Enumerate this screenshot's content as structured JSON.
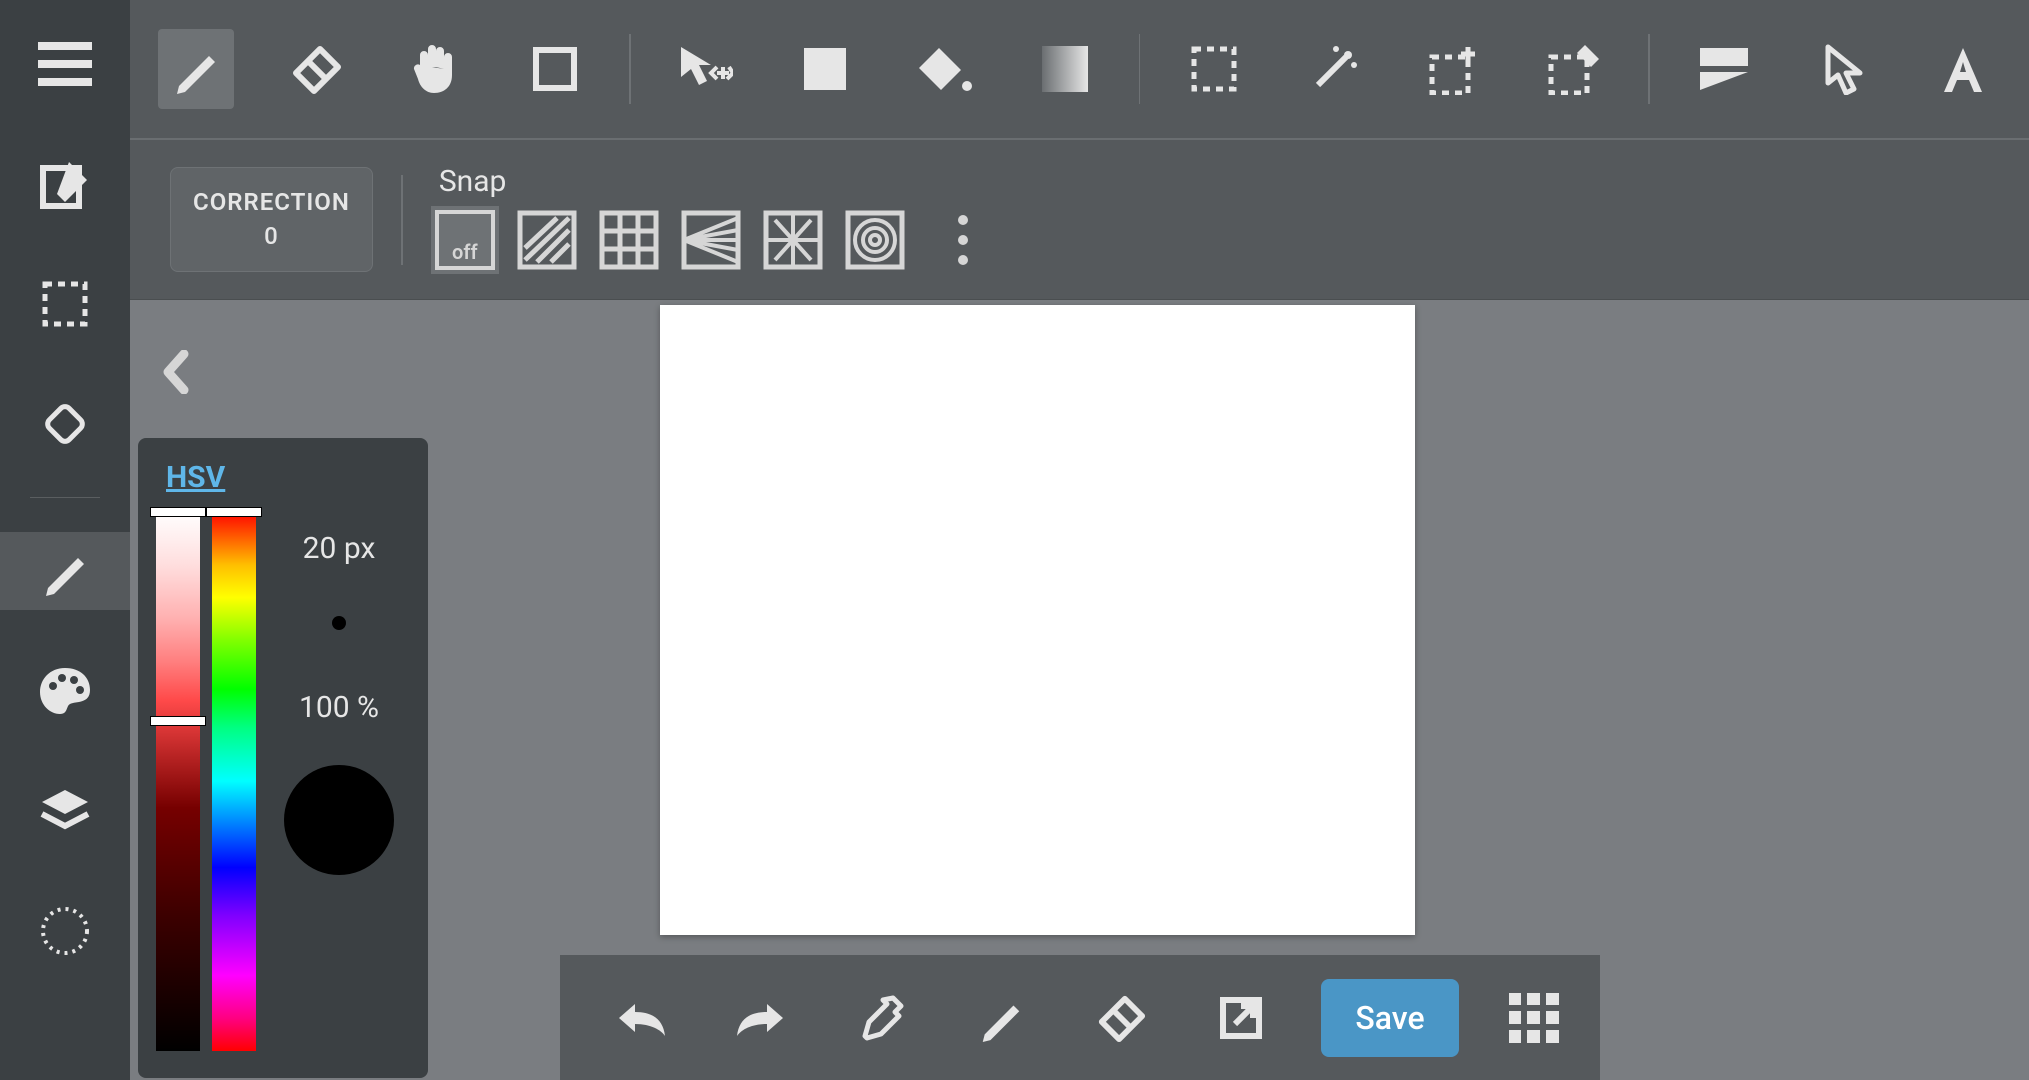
{
  "sidebar": {
    "items": [
      {
        "name": "menu",
        "icon": "hamburger"
      },
      {
        "name": "edit",
        "icon": "edit-square"
      },
      {
        "name": "marquee",
        "icon": "marquee-dashed"
      },
      {
        "name": "rotate",
        "icon": "rotate-diamond"
      },
      {
        "name": "brush",
        "icon": "pencil",
        "active": true
      },
      {
        "name": "palette",
        "icon": "palette"
      },
      {
        "name": "layers",
        "icon": "layers"
      },
      {
        "name": "canvas-settings",
        "icon": "dotted-circle"
      }
    ]
  },
  "toolbar": {
    "tools": [
      {
        "name": "pencil",
        "icon": "pencil",
        "active": true
      },
      {
        "name": "eraser",
        "icon": "eraser"
      },
      {
        "name": "pan",
        "icon": "hand"
      },
      {
        "name": "shape",
        "icon": "rect-outline"
      },
      {
        "sep": true
      },
      {
        "name": "move-select",
        "icon": "cursor-move"
      },
      {
        "name": "fill-rect",
        "icon": "square-fill"
      },
      {
        "name": "bucket",
        "icon": "bucket"
      },
      {
        "name": "gradient",
        "icon": "gradient"
      },
      {
        "sep": true
      },
      {
        "name": "select-rect",
        "icon": "marquee-dashed"
      },
      {
        "name": "wand",
        "icon": "wand"
      },
      {
        "name": "select-add",
        "icon": "marquee-plus"
      },
      {
        "name": "select-erase",
        "icon": "marquee-eraser"
      },
      {
        "sep": true
      },
      {
        "name": "frames",
        "icon": "frames"
      },
      {
        "name": "cursor-outline",
        "icon": "cursor-outline"
      },
      {
        "name": "text",
        "icon": "text-A"
      }
    ]
  },
  "correction": {
    "label": "CORRECTION",
    "value": "0"
  },
  "snap": {
    "label": "Snap",
    "off_label": "off",
    "buttons": [
      {
        "name": "off",
        "active": true
      },
      {
        "name": "parallel"
      },
      {
        "name": "grid"
      },
      {
        "name": "horizontal"
      },
      {
        "name": "radial"
      },
      {
        "name": "concentric"
      }
    ]
  },
  "hsv": {
    "title": "HSV",
    "brush_size": "20 px",
    "opacity": "100 %",
    "current_color": "#000000",
    "sv_handle_pos_pct": 0,
    "value_handle_pos_pct": 38,
    "hue_handle_pos_pct": 0
  },
  "bottom_bar": {
    "buttons": [
      {
        "name": "undo",
        "icon": "undo"
      },
      {
        "name": "redo",
        "icon": "redo"
      },
      {
        "name": "eyedropper",
        "icon": "eyedropper"
      },
      {
        "name": "pencil",
        "icon": "pencil"
      },
      {
        "name": "eraser",
        "icon": "eraser"
      },
      {
        "name": "fullscreen",
        "icon": "open-external"
      }
    ],
    "save_label": "Save"
  },
  "colors": {
    "accent": "#4a96c6",
    "panel_dark": "#3b4043",
    "panel_mid": "#55595c",
    "canvas_bg": "#7a7d81"
  }
}
